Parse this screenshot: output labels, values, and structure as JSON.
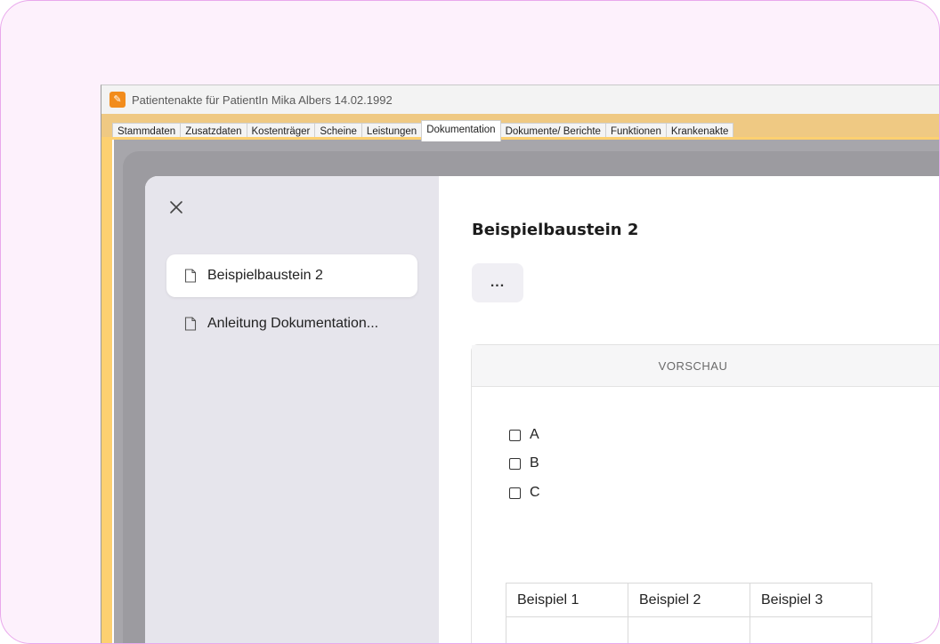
{
  "window": {
    "title": "Patientenakte für PatientIn Mika Albers 14.02.1992",
    "icon": "app-logo-icon",
    "accent_color": "#f28c1c"
  },
  "tabs": [
    {
      "label": "Stammdaten",
      "active": false
    },
    {
      "label": "Zusatzdaten",
      "active": false
    },
    {
      "label": "Kostenträger",
      "active": false
    },
    {
      "label": "Scheine",
      "active": false
    },
    {
      "label": "Leistungen",
      "active": false
    },
    {
      "label": "Dokumentation",
      "active": true
    },
    {
      "label": "Dokumente/ Berichte",
      "active": false
    },
    {
      "label": "Funktionen",
      "active": false
    },
    {
      "label": "Krankenakte",
      "active": false
    }
  ],
  "sidebar": {
    "close_icon": "close-icon",
    "items": [
      {
        "label": "Beispielbaustein 2",
        "icon": "document-icon",
        "selected": true
      },
      {
        "label": "Anleitung Dokumentation...",
        "icon": "document-icon",
        "selected": false
      }
    ]
  },
  "main": {
    "heading": "Beispielbaustein 2",
    "more_button": "...",
    "preview": {
      "header": "VORSCHAU",
      "checkboxes": [
        {
          "label": "A",
          "checked": false
        },
        {
          "label": "B",
          "checked": false
        },
        {
          "label": "C",
          "checked": false
        }
      ],
      "table_headers": [
        "Beispiel 1",
        "Beispiel 2",
        "Beispiel 3"
      ]
    }
  }
}
